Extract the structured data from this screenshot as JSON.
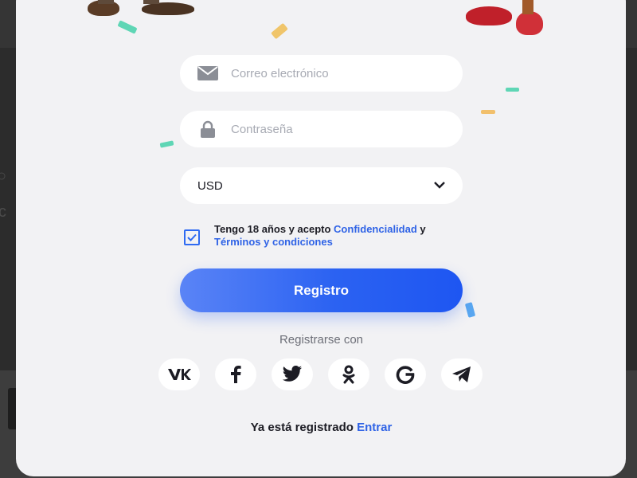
{
  "form": {
    "email_placeholder": "Correo electrónico",
    "password_placeholder": "Contraseña",
    "currency_value": "USD",
    "terms_prefix": "Tengo 18 años y acepto",
    "terms_privacy_link": "Confidencialidad",
    "terms_and": "y",
    "terms_conditions_link": "Términos y condiciones",
    "terms_checked": true,
    "register_button": "Registro"
  },
  "social": {
    "heading": "Registrarse con",
    "providers": [
      "vk-icon",
      "facebook-icon",
      "twitter-icon",
      "odnoklassniki-icon",
      "google-icon",
      "telegram-icon"
    ]
  },
  "footer": {
    "already_registered": "Ya está registrado",
    "login_link": "Entrar"
  },
  "colors": {
    "accent": "#2f63e6",
    "button_start": "#5a84f6",
    "button_end": "#1e56f2",
    "modal_bg": "#f2f2f4",
    "field_bg": "#ffffff",
    "placeholder": "#a7aab3"
  }
}
